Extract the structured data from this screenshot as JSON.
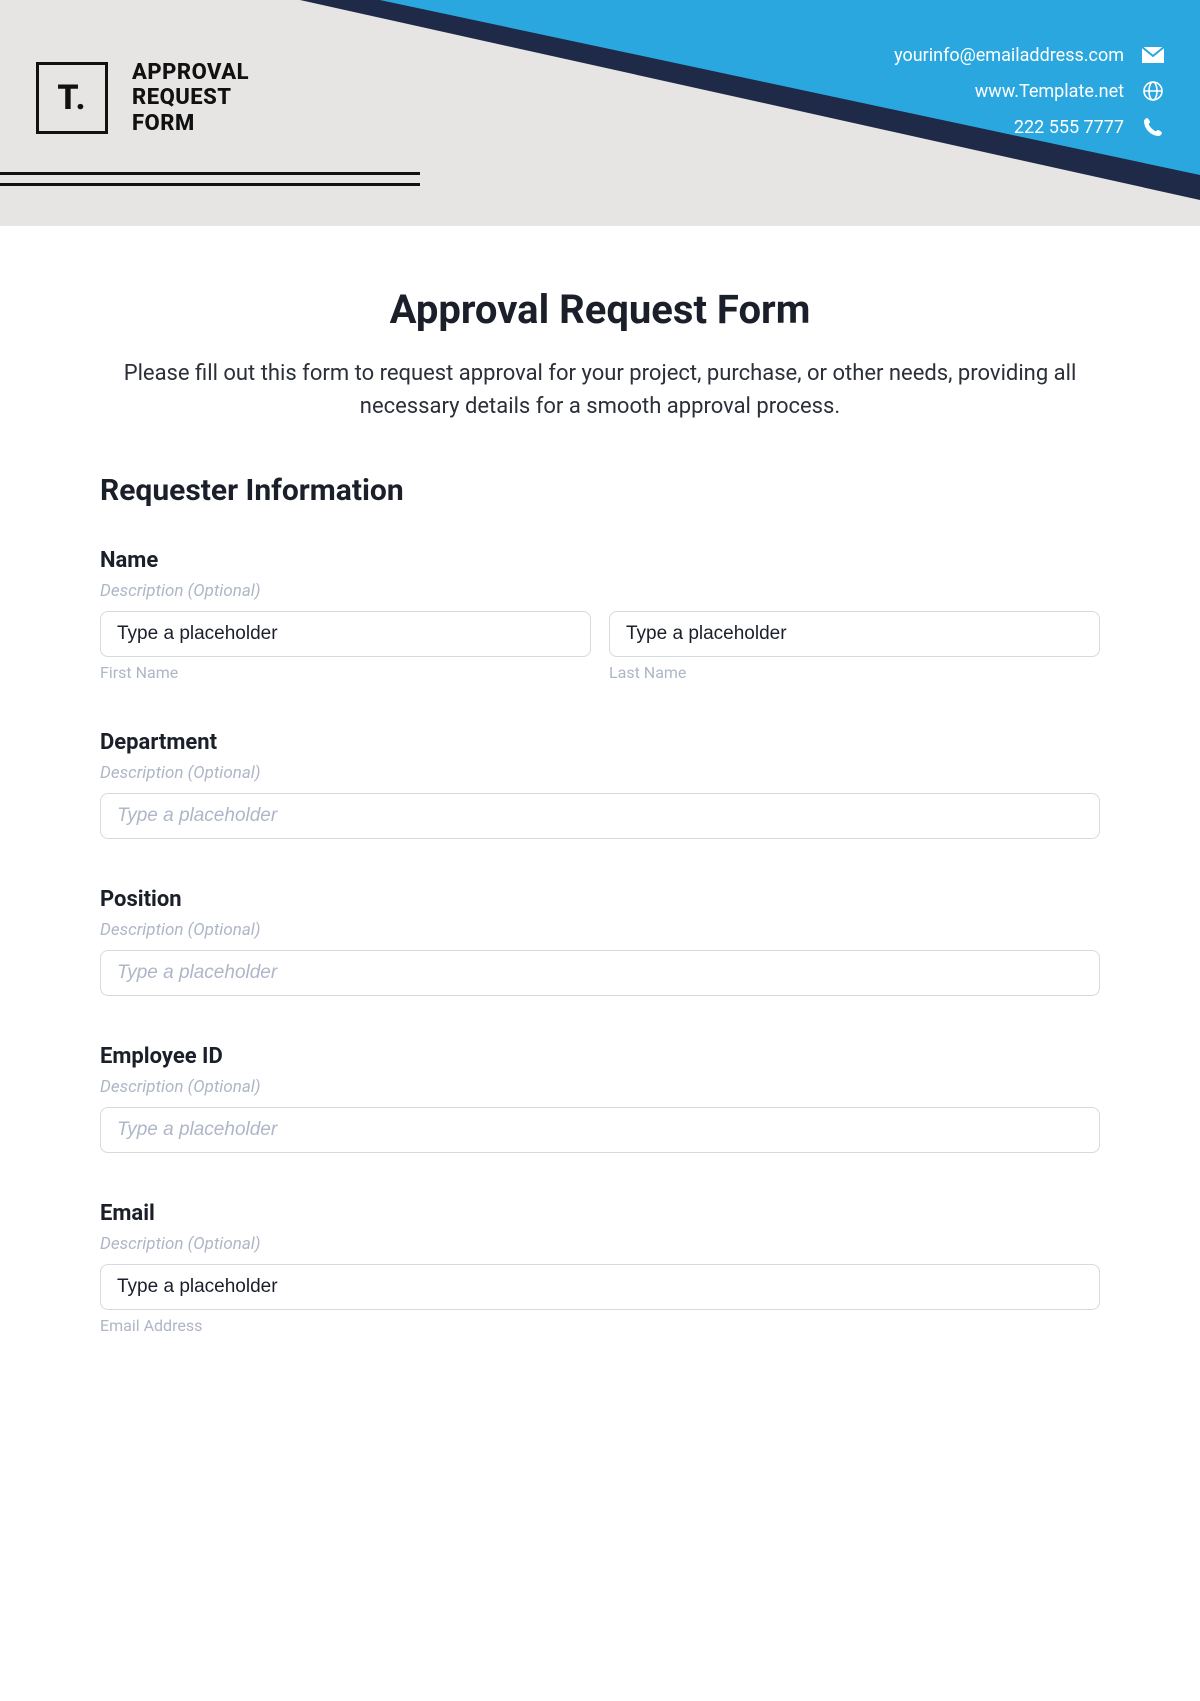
{
  "header": {
    "logo_text": "T.",
    "logo_label": "APPROVAL\nREQUEST\nFORM",
    "contact": {
      "email": "yourinfo@emailaddress.com",
      "website": "www.Template.net",
      "phone": "222 555 7777"
    }
  },
  "form": {
    "title": "Approval Request Form",
    "description": "Please fill out this form to request approval for your project, purchase, or other needs, providing all necessary details for a smooth approval process.",
    "section_title": "Requester Information",
    "desc_optional": "Description (Optional)",
    "fields": {
      "name": {
        "label": "Name",
        "first_placeholder": "Type a placeholder",
        "first_sub": "First Name",
        "last_placeholder": "Type a placeholder",
        "last_sub": "Last Name"
      },
      "department": {
        "label": "Department",
        "placeholder": "Type a placeholder"
      },
      "position": {
        "label": "Position",
        "placeholder": "Type a placeholder"
      },
      "employee_id": {
        "label": "Employee ID",
        "placeholder": "Type a placeholder"
      },
      "email": {
        "label": "Email",
        "placeholder": "Type a placeholder",
        "sub": "Email Address"
      }
    }
  }
}
